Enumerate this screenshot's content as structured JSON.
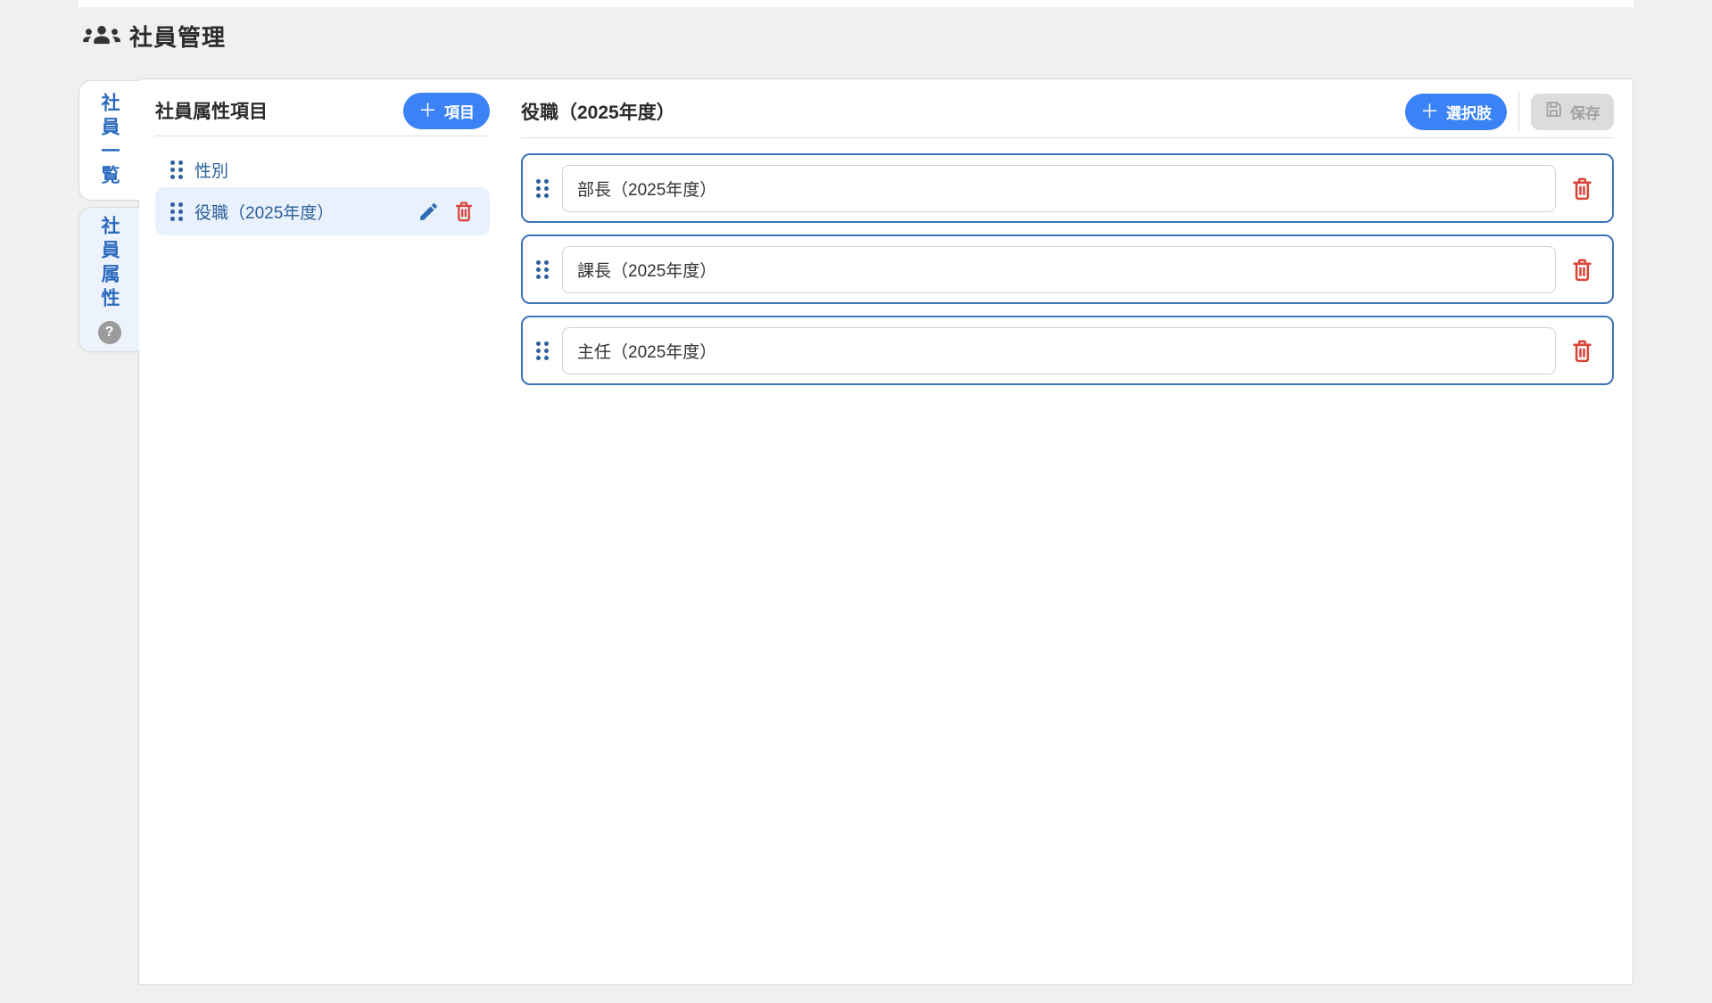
{
  "app": {
    "title": "社員管理",
    "title_icon": "people-group-icon"
  },
  "colors": {
    "accent_blue": "#3b82f6",
    "item_text_blue": "#2d609b",
    "card_border_blue": "#3d74b8",
    "danger_red": "#d9453a",
    "selected_item_bg": "#e9f1fc",
    "active_tab_bg": "#edf3fc",
    "disabled_button_bg": "#dcdcdc",
    "disabled_button_text": "#a2a2a2",
    "page_bg": "#f0f0ee"
  },
  "side_tabs": [
    {
      "label": "社員一覧",
      "active": false
    },
    {
      "label": "社員属性",
      "active": true,
      "help_glyph": "?"
    }
  ],
  "left_panel": {
    "title": "社員属性項目",
    "add_button": {
      "plus": "＋",
      "label": "項目"
    },
    "items": [
      {
        "label": "性別",
        "selected": false
      },
      {
        "label": "役職（2025年度）",
        "selected": true
      }
    ]
  },
  "right_panel": {
    "title": "役職（2025年度）",
    "add_option_button": {
      "plus": "＋",
      "label": "選択肢"
    },
    "save_button": {
      "label": "保存",
      "disabled": true
    },
    "options": [
      "部長（2025年度）",
      "課長（2025年度）",
      "主任（2025年度）"
    ]
  }
}
